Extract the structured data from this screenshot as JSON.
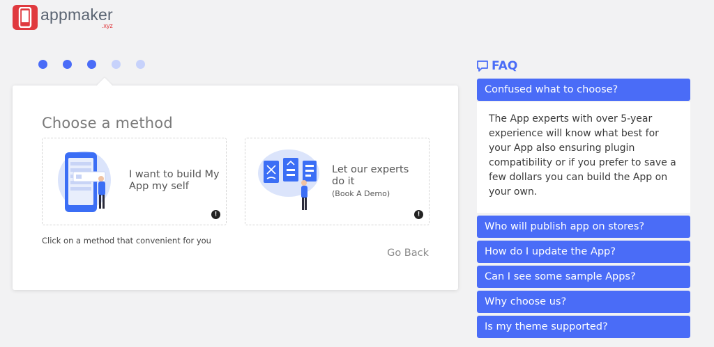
{
  "brand": {
    "name": "appmaker",
    "suffix": ".xyz",
    "accent": "#e0393e"
  },
  "steps": {
    "total": 5,
    "completed": 3,
    "active_color": "#4a6cf7",
    "inactive_color": "#c7d2fb"
  },
  "card": {
    "title": "Choose a method",
    "options": [
      {
        "label": "I want to build My App my self",
        "sublabel": "",
        "icon": "phone-builder-illustration"
      },
      {
        "label": "Let our experts do it",
        "sublabel": "(Book A Demo)",
        "icon": "experts-wireframe-illustration"
      }
    ],
    "hint": "Click on a method that convenient for you",
    "back_label": "Go Back"
  },
  "faq": {
    "title": "FAQ",
    "icon": "chat-bubble-icon",
    "accent": "#4a6cf7",
    "items": [
      {
        "question": "Confused what to choose?",
        "answer": "The App experts with over 5-year experience will know what best for your App also ensuring plugin compatibility or if you prefer to save a few dollars you can build the App on your own.",
        "expanded": true
      },
      {
        "question": "Who will publish app on stores?"
      },
      {
        "question": "How do I update the App?"
      },
      {
        "question": "Can I see some sample Apps?"
      },
      {
        "question": "Why choose us?"
      },
      {
        "question": "Is my theme supported?"
      }
    ]
  }
}
